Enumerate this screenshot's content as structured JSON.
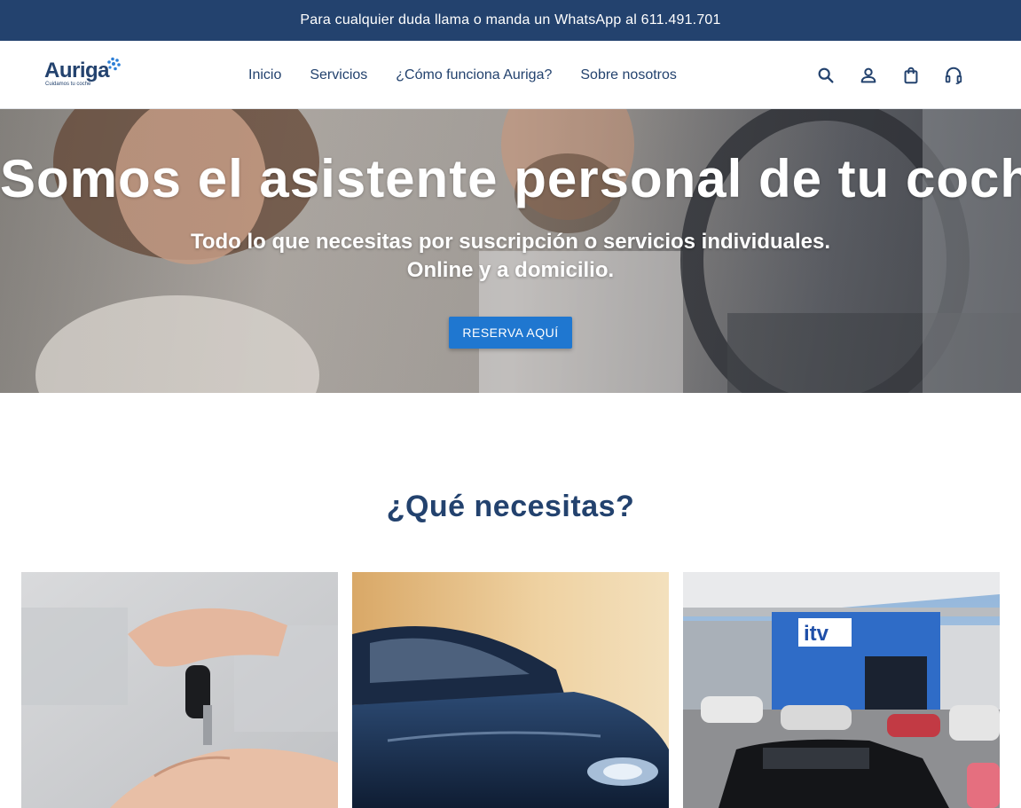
{
  "topbar": {
    "text": "Para cualquier duda llama o manda un WhatsApp al 611.491.701"
  },
  "logo": {
    "name": "Auriga",
    "tagline": "Cuidamos tu coche"
  },
  "nav": {
    "items": [
      "Inicio",
      "Servicios",
      "¿Cómo funciona Auriga?",
      "Sobre nosotros"
    ]
  },
  "header_icons": [
    "search-icon",
    "user-icon",
    "shopping-bag-icon",
    "headset-icon"
  ],
  "hero": {
    "title": "Somos el asistente personal de tu coche",
    "subtitle_line1": "Todo lo que necesitas por suscripción o servicios individuales.",
    "subtitle_line2": "Online y a domicilio.",
    "cta": "RESERVA AQUÍ"
  },
  "section": {
    "title": "¿Qué necesitas?"
  },
  "colors": {
    "primary": "#23426e",
    "accent": "#1f77d0",
    "background": "#ffffff"
  },
  "cards": [
    {
      "image": "car-keys-handover-photo"
    },
    {
      "image": "dark-blue-car-photo"
    },
    {
      "image": "itv-inspection-station-photo",
      "sign_text": "itv"
    }
  ]
}
